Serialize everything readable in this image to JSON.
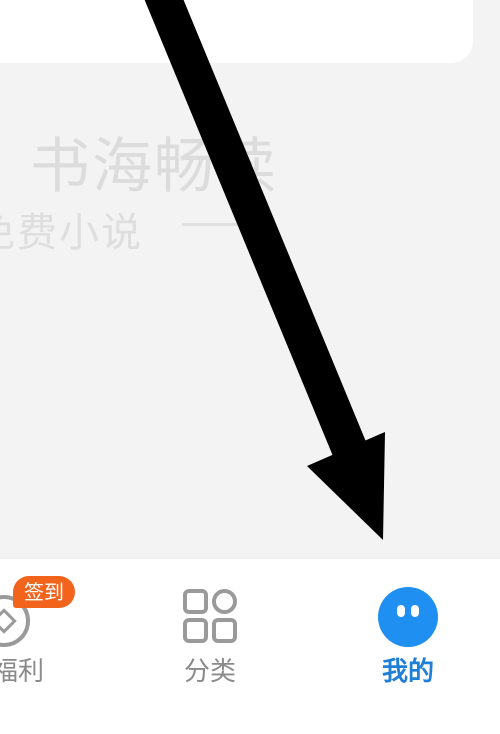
{
  "watermark": {
    "title": "书海畅读",
    "subtitle": "免费小说"
  },
  "bottom_nav": {
    "items": [
      {
        "label": "福利",
        "icon": "welfare-coin-icon",
        "badge": "签到"
      },
      {
        "label": "分类",
        "icon": "grid-category-icon"
      },
      {
        "label": "我的",
        "icon": "profile-face-icon",
        "active": true
      }
    ],
    "active_color": "#1f7fd6",
    "inactive_color": "#8a8a8a",
    "badge_color": "#f2631c"
  },
  "annotation": {
    "arrow_color": "#000000",
    "points_to": "我的"
  }
}
